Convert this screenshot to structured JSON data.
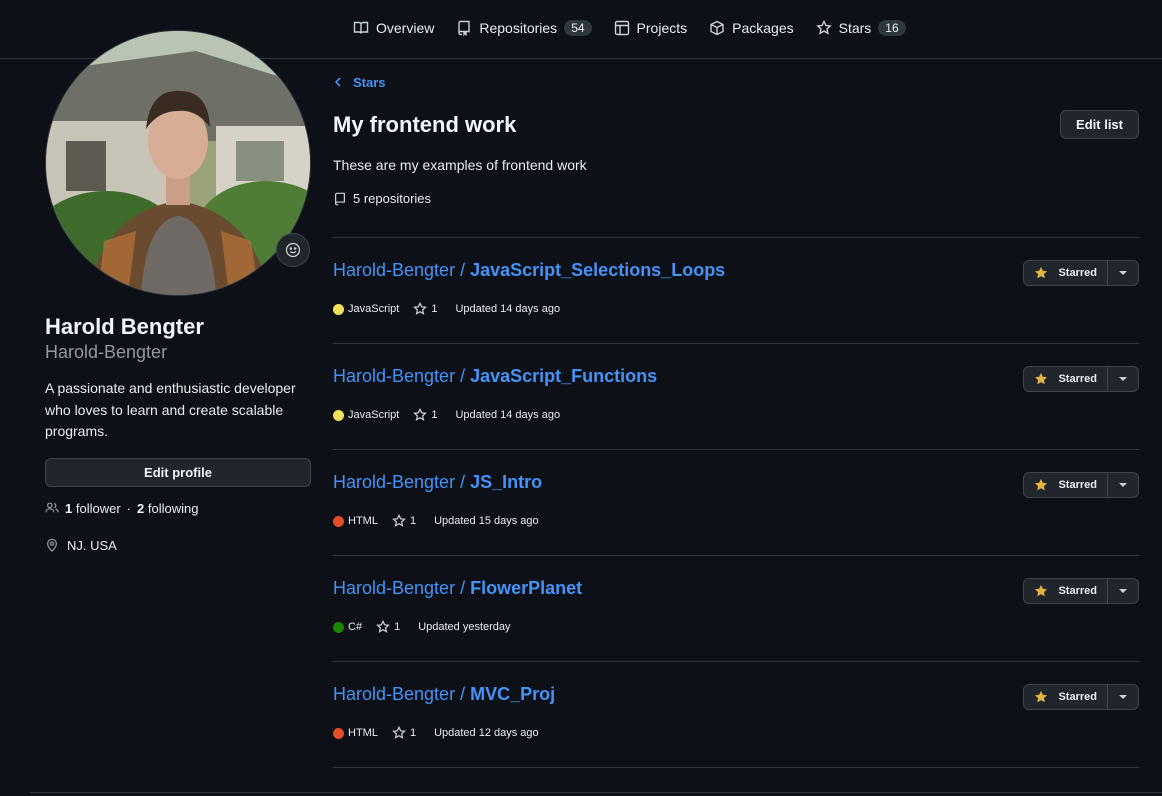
{
  "nav": {
    "tabs": [
      {
        "label": "Overview",
        "icon": "book-icon"
      },
      {
        "label": "Repositories",
        "icon": "repo-icon",
        "count": "54"
      },
      {
        "label": "Projects",
        "icon": "table-icon"
      },
      {
        "label": "Packages",
        "icon": "package-icon"
      },
      {
        "label": "Stars",
        "icon": "star-icon",
        "count": "16"
      }
    ]
  },
  "profile": {
    "name": "Harold Bengter",
    "login": "Harold-Bengter",
    "bio": "A passionate and enthusiastic developer who loves to learn and create scalable programs.",
    "edit_label": "Edit profile",
    "followers": "1",
    "followers_label": "follower",
    "following": "2",
    "following_label": "following",
    "separator": "·",
    "location": "NJ. USA"
  },
  "list": {
    "back_label": "Stars",
    "title": "My frontend work",
    "edit_label": "Edit list",
    "description": "These are my examples of frontend work",
    "repo_count": "5 repositories"
  },
  "repos": [
    {
      "owner": "Harold-Bengter /",
      "name": "JavaScript_Selections_Loops",
      "lang": "JavaScript",
      "lang_color": "#f1e05a",
      "stars": "1",
      "updated": "Updated 14 days ago",
      "star_label": "Starred"
    },
    {
      "owner": "Harold-Bengter /",
      "name": "JavaScript_Functions",
      "lang": "JavaScript",
      "lang_color": "#f1e05a",
      "stars": "1",
      "updated": "Updated 14 days ago",
      "star_label": "Starred"
    },
    {
      "owner": "Harold-Bengter /",
      "name": "JS_Intro",
      "lang": "HTML",
      "lang_color": "#e34c26",
      "stars": "1",
      "updated": "Updated 15 days ago",
      "star_label": "Starred"
    },
    {
      "owner": "Harold-Bengter /",
      "name": "FlowerPlanet",
      "lang": "C#",
      "lang_color": "#178600",
      "stars": "1",
      "updated": "Updated yesterday",
      "star_label": "Starred"
    },
    {
      "owner": "Harold-Bengter /",
      "name": "MVC_Proj",
      "lang": "HTML",
      "lang_color": "#e34c26",
      "stars": "1",
      "updated": "Updated 12 days ago",
      "star_label": "Starred"
    }
  ]
}
